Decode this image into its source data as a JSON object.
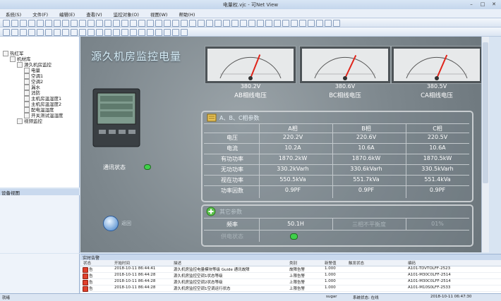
{
  "window": {
    "title": "电量权.vjc - 可Net View"
  },
  "menu": [
    "系统(S)",
    "文件(F)",
    "编辑(E)",
    "查看(V)",
    "监控对象(O)",
    "视图(W)",
    "帮助(H)"
  ],
  "tree": {
    "items": [
      {
        "label": "热红军",
        "indent": 0
      },
      {
        "label": "机材库",
        "indent": 1
      },
      {
        "label": "源久机房监控",
        "indent": 2
      },
      {
        "label": "电量",
        "indent": 3
      },
      {
        "label": "空调1",
        "indent": 3
      },
      {
        "label": "空调2",
        "indent": 3
      },
      {
        "label": "漏水",
        "indent": 3
      },
      {
        "label": "消防",
        "indent": 3
      },
      {
        "label": "主机房温湿度1",
        "indent": 3
      },
      {
        "label": "主机房温湿度2",
        "indent": 3
      },
      {
        "label": "配电温湿度",
        "indent": 3
      },
      {
        "label": "开关测试温湿度",
        "indent": 3
      },
      {
        "label": "视频监控",
        "indent": 2
      }
    ]
  },
  "device_panel_title": "设备视图",
  "main": {
    "title": "源久机房监控电量",
    "meters": [
      {
        "value": "380.2V",
        "label": "AB相线电压"
      },
      {
        "value": "380.6V",
        "label": "BC相线电压"
      },
      {
        "value": "380.5V",
        "label": "CA相线电压"
      }
    ],
    "comm_label": "通讯状态",
    "back_label": "返回",
    "table": {
      "header": "A、B、C相参数",
      "columns": [
        "A相",
        "B相",
        "C相"
      ],
      "rows": [
        {
          "label": "电压",
          "values": [
            "220.2V",
            "220.6V",
            "220.5V"
          ]
        },
        {
          "label": "电流",
          "values": [
            "10.2A",
            "10.6A",
            "10.6A"
          ]
        },
        {
          "label": "有功功率",
          "values": [
            "1870.2kW",
            "1870.6kW",
            "1870.5kW"
          ]
        },
        {
          "label": "无功功率",
          "values": [
            "330.2kVarh",
            "330.6kVarh",
            "330.5kVarh"
          ]
        },
        {
          "label": "视在功率",
          "values": [
            "550.5kVa",
            "551.7kVa",
            "551.4kVa"
          ]
        },
        {
          "label": "功率因数",
          "values": [
            "0.9PF",
            "0.9PF",
            "0.9PF"
          ]
        }
      ]
    },
    "power": {
      "header": "其它参数",
      "freq_label": "频率",
      "freq_value": "50.1H",
      "unbalance_label": "三相不平衡度",
      "unbalance_value": "01%",
      "supply_label": "供电状态"
    }
  },
  "alarm": {
    "title": "实时告警",
    "columns": [
      "状态",
      "开始时间",
      "描述",
      "类别",
      "新警值",
      "触发状态",
      "编码"
    ],
    "rows": [
      {
        "status": "告",
        "time": "2018-10-11 86:44:41",
        "desc": "源久机房监控电量模块等级 Guide 通讯故障",
        "category": "故障告警",
        "value": "1.000",
        "code": "A101-TDVTOLFF-2523"
      },
      {
        "status": "告",
        "time": "2018-10-11 86:44:28",
        "desc": "源久机房监控空调1状态等级",
        "category": "上限告警",
        "value": "1.000",
        "code": "A101-M30C0LFF-2514"
      },
      {
        "status": "告",
        "time": "2018-10-11 86:44:28",
        "desc": "源久机房监控空调2状态等级",
        "category": "上限告警",
        "value": "1.000",
        "code": "A101-M30C0LFF-2514"
      },
      {
        "status": "告",
        "time": "2018-10-11 86:44:28",
        "desc": "源久机房监控空调1空调运行状态",
        "category": "上限告警",
        "value": "1.000",
        "code": "A101-M10S0LFF-2533"
      }
    ]
  },
  "status": {
    "left": "就绪",
    "user": "sugar",
    "state": "系统状态: 在线",
    "time": "2018-10-11 06:47:30"
  },
  "colors": {
    "needle": "#e0241a",
    "led": "#3fd04a",
    "alarm_icon": "#e0402c"
  },
  "meter_levels": [
    0.62,
    0.64,
    0.63
  ]
}
